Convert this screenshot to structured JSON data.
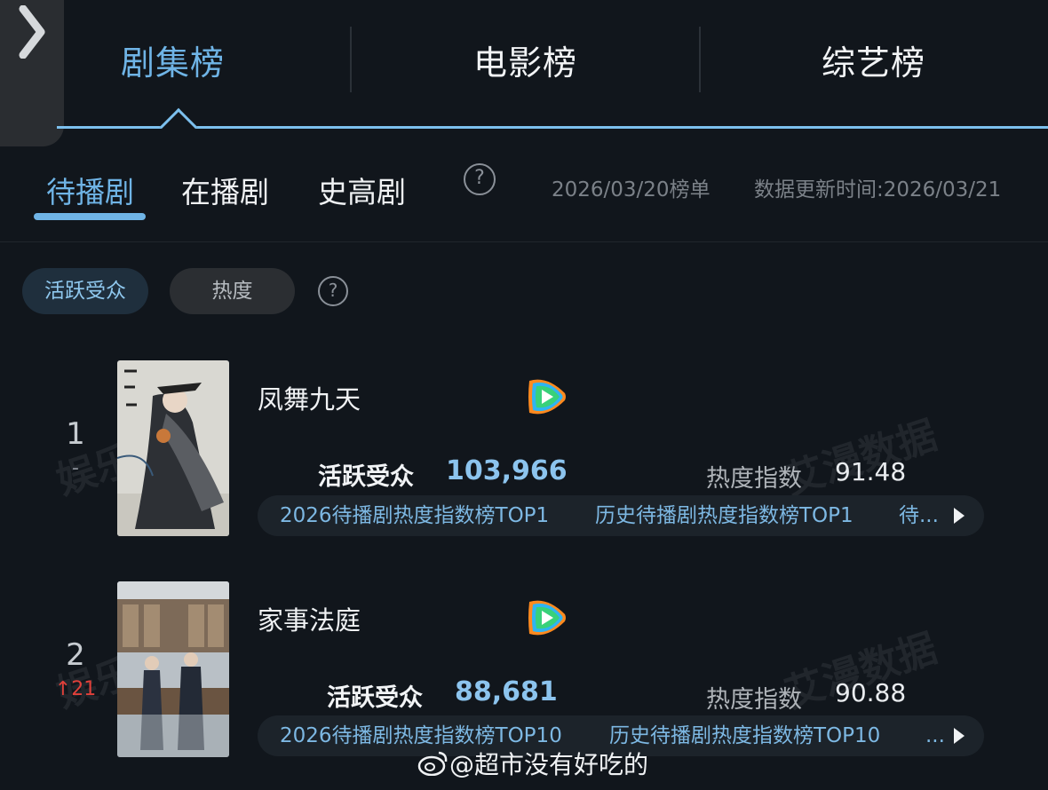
{
  "top_tabs": [
    {
      "label": "剧集榜",
      "active": true
    },
    {
      "label": "电影榜",
      "active": false
    },
    {
      "label": "综艺榜",
      "active": false
    }
  ],
  "sub_tabs": [
    {
      "label": "待播剧",
      "active": true
    },
    {
      "label": "在播剧",
      "active": false
    },
    {
      "label": "史高剧",
      "active": false
    }
  ],
  "help_icon": "question-circle-icon",
  "list_date": "2026/03/20榜单",
  "update_time": "数据更新时间:2026/03/21",
  "filters": [
    {
      "label": "活跃受众",
      "active": true
    },
    {
      "label": "热度",
      "active": false
    }
  ],
  "items": [
    {
      "rank": "1",
      "rank_change": "-",
      "rank_change_type": "flat",
      "title": "凤舞九天",
      "platform_icon": "tencent-video-icon",
      "audience_label": "活跃受众",
      "audience_value": "103,966",
      "heat_label": "热度指数",
      "heat_value": "91.48",
      "tags": [
        "2026待播剧热度指数榜TOP1",
        "历史待播剧热度指数榜TOP1",
        "待..."
      ]
    },
    {
      "rank": "2",
      "rank_change": "↑21",
      "rank_change_type": "up",
      "title": "家事法庭",
      "platform_icon": "tencent-video-icon",
      "audience_label": "活跃受众",
      "audience_value": "88,681",
      "heat_label": "热度指数",
      "heat_value": "90.88",
      "tags": [
        "2026待播剧热度指数榜TOP10",
        "历史待播剧热度指数榜TOP10",
        "..."
      ]
    }
  ],
  "watermarks": [
    "娱乐指数",
    "艾漫数据"
  ],
  "weibo_handle": "@超市没有好吃的",
  "colors": {
    "background": "#11161c",
    "accent": "#6fb4e6",
    "value": "#8cc4ee",
    "rank_up": "#e0403a"
  }
}
